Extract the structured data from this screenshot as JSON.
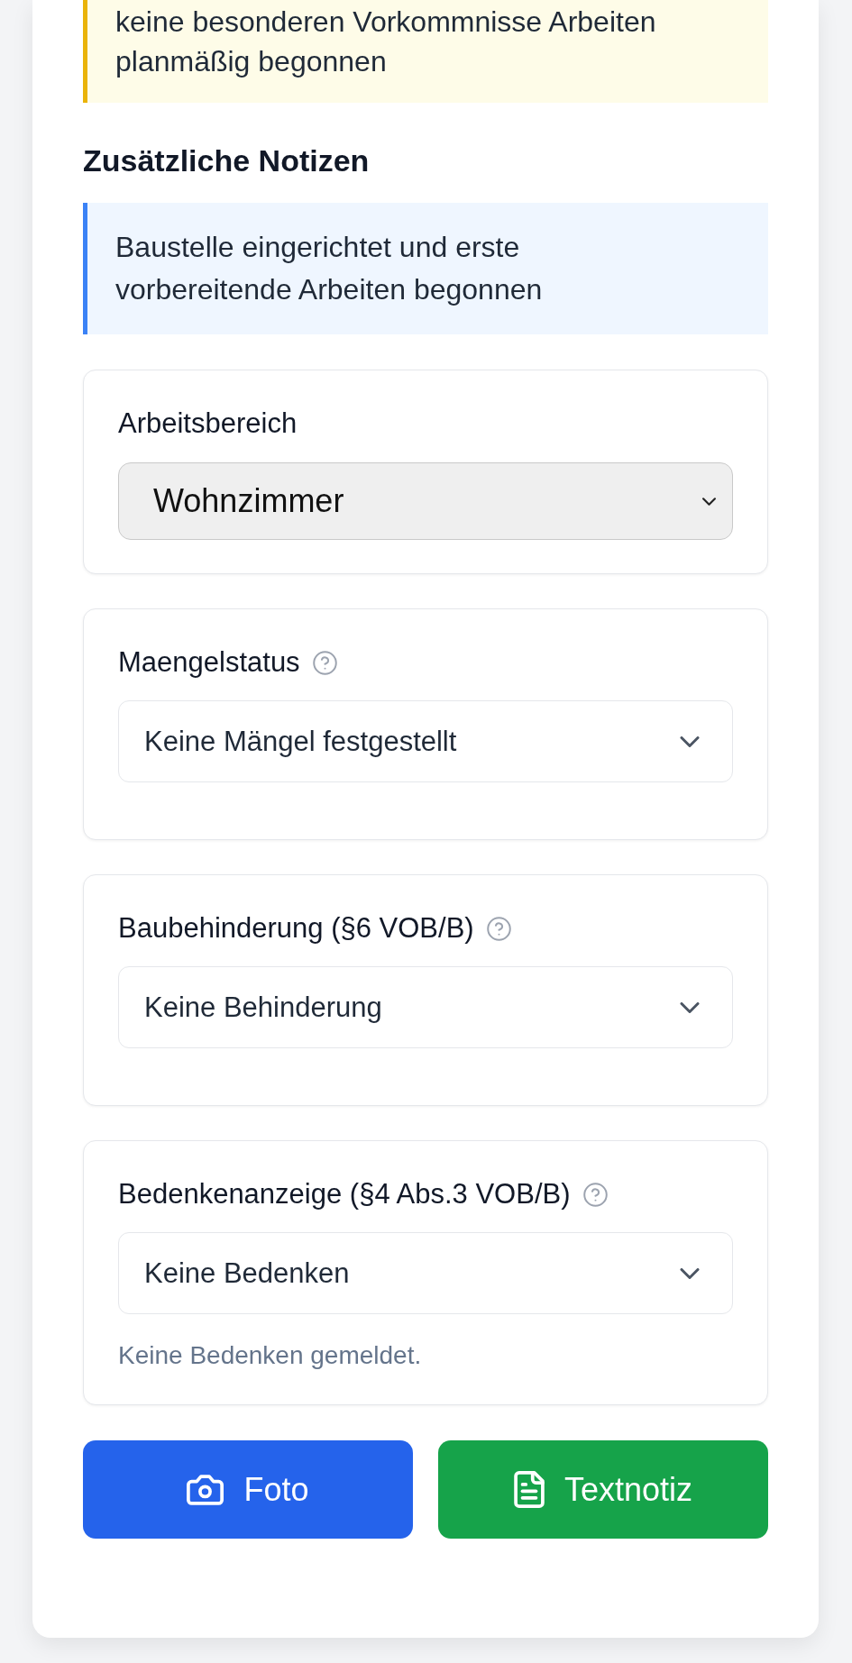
{
  "status_callout": {
    "text": "keine besonderen Vorkommnisse Arbeiten planmäßig begonnen"
  },
  "additional_notes": {
    "heading": "Zusätzliche Notizen",
    "text": "Baustelle eingerichtet und erste vorbereitende Arbeiten begonnen"
  },
  "fields": [
    {
      "kind": "native_select",
      "label": "Arbeitsbereich",
      "help": false,
      "value": "Wohnzimmer"
    },
    {
      "kind": "select",
      "label": "Maengelstatus",
      "help": true,
      "value": "Keine Mängel festgestellt"
    },
    {
      "kind": "select",
      "label": "Baubehinderung (§6 VOB/B)",
      "help": true,
      "value": "Keine Behinderung"
    },
    {
      "kind": "select",
      "label": "Bedenkenanzeige (§4 Abs.3 VOB/B)",
      "help": true,
      "value": "Keine Bedenken",
      "hint": "Keine Bedenken gemeldet."
    }
  ],
  "buttons": [
    {
      "kind": "photo",
      "label": "Foto"
    },
    {
      "kind": "note",
      "label": "Textnotiz"
    }
  ]
}
